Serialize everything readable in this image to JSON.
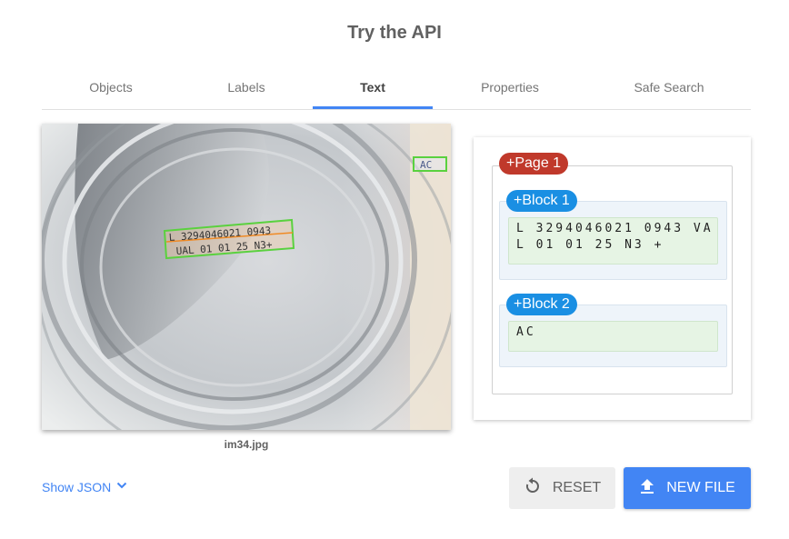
{
  "page": {
    "title": "Try the API"
  },
  "tabs": [
    {
      "label": "Objects",
      "active": false
    },
    {
      "label": "Labels",
      "active": false
    },
    {
      "label": "Text",
      "active": true
    },
    {
      "label": "Properties",
      "active": false
    },
    {
      "label": "Safe Search",
      "active": false
    }
  ],
  "image": {
    "filename": "im34.jpg",
    "overlay_text_line1": "L  3294046021 0943",
    "overlay_text_line2": "UAL 01 01 25 N3+",
    "overlay_text_corner": "AC"
  },
  "results": {
    "page_label": "+Page 1",
    "blocks": [
      {
        "label": "+Block 1",
        "lines": [
          "L 3294046021 0943 VA",
          "L 01 01 25 N3 +"
        ]
      },
      {
        "label": "+Block 2",
        "lines": [
          "AC"
        ]
      }
    ]
  },
  "controls": {
    "show_json_label": "Show JSON",
    "reset_label": "RESET",
    "new_file_label": "NEW FILE"
  },
  "colors": {
    "accent": "#4285f4",
    "page_pill": "#c0392b",
    "block_pill": "#1a8fe3",
    "detection_box": "#5ad13f"
  },
  "icons": {
    "show_json": "chevron-down-icon",
    "reset": "reset-icon",
    "new_file": "upload-icon"
  }
}
